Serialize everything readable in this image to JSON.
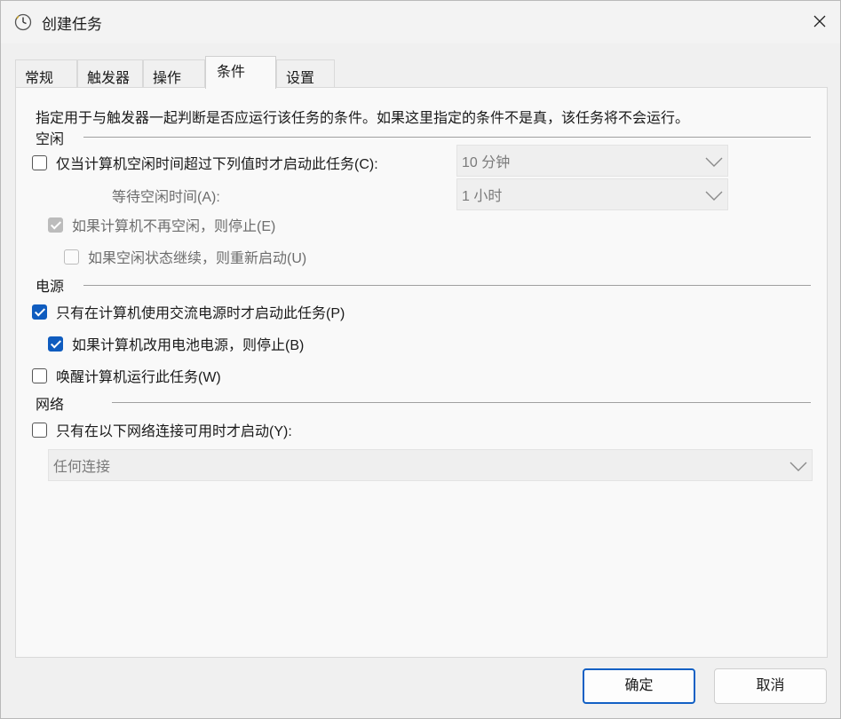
{
  "window": {
    "title": "创建任务"
  },
  "tabs": [
    {
      "label": "常规"
    },
    {
      "label": "触发器"
    },
    {
      "label": "操作"
    },
    {
      "label": "条件"
    },
    {
      "label": "设置"
    }
  ],
  "description": "指定用于与触发器一起判断是否应运行该任务的条件。如果这里指定的条件不是真，该任务将不会运行。",
  "idle": {
    "label": "空闲",
    "start_if_idle": {
      "label": "仅当计算机空闲时间超过下列值时才启动此任务(C):",
      "checked": false
    },
    "idle_duration": {
      "value": "10 分钟"
    },
    "wait_label": "等待空闲时间(A):",
    "wait_duration": {
      "value": "1 小时"
    },
    "stop_if_not_idle": {
      "label": "如果计算机不再空闲，则停止(E)",
      "checked": true
    },
    "restart_if_idle": {
      "label": "如果空闲状态继续，则重新启动(U)",
      "checked": false
    }
  },
  "power": {
    "label": "电源",
    "ac_only": {
      "label": "只有在计算机使用交流电源时才启动此任务(P)",
      "checked": true
    },
    "stop_on_battery": {
      "label": "如果计算机改用电池电源，则停止(B)",
      "checked": true
    },
    "wake": {
      "label": "唤醒计算机运行此任务(W)",
      "checked": false
    }
  },
  "network": {
    "label": "网络",
    "only_if_network": {
      "label": "只有在以下网络连接可用时才启动(Y):",
      "checked": false
    },
    "connection": {
      "value": "任何连接"
    }
  },
  "buttons": {
    "ok": "确定",
    "cancel": "取消"
  }
}
